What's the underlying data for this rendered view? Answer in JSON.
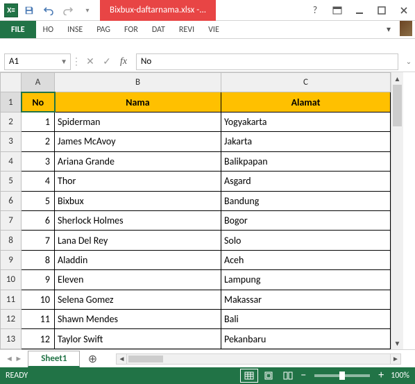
{
  "title": "Bixbux-daftarnama.xlsx -...",
  "ribbon": {
    "file": "FILE",
    "tabs": [
      "HO",
      "INSE",
      "PAG",
      "FOR",
      "DAT",
      "REVI",
      "VIE"
    ]
  },
  "namebox": "A1",
  "formula": "No",
  "columns": [
    "A",
    "B",
    "C"
  ],
  "headers": {
    "no": "No",
    "nama": "Nama",
    "alamat": "Alamat"
  },
  "rows": [
    {
      "no": "1",
      "nama": "Spiderman",
      "alamat": "Yogyakarta"
    },
    {
      "no": "2",
      "nama": "James McAvoy",
      "alamat": "Jakarta"
    },
    {
      "no": "3",
      "nama": "Ariana Grande",
      "alamat": "Balikpapan"
    },
    {
      "no": "4",
      "nama": "Thor",
      "alamat": "Asgard"
    },
    {
      "no": "5",
      "nama": "Bixbux",
      "alamat": "Bandung"
    },
    {
      "no": "6",
      "nama": "Sherlock Holmes",
      "alamat": "Bogor"
    },
    {
      "no": "7",
      "nama": "Lana Del Rey",
      "alamat": "Solo"
    },
    {
      "no": "8",
      "nama": "Aladdin",
      "alamat": "Aceh"
    },
    {
      "no": "9",
      "nama": "Eleven",
      "alamat": "Lampung"
    },
    {
      "no": "10",
      "nama": "Selena Gomez",
      "alamat": "Makassar"
    },
    {
      "no": "11",
      "nama": "Shawn Mendes",
      "alamat": "Bali"
    },
    {
      "no": "12",
      "nama": "Taylor Swift",
      "alamat": "Pekanbaru"
    }
  ],
  "sheet": {
    "name": "Sheet1"
  },
  "status": {
    "ready": "READY",
    "zoom": "100%"
  }
}
